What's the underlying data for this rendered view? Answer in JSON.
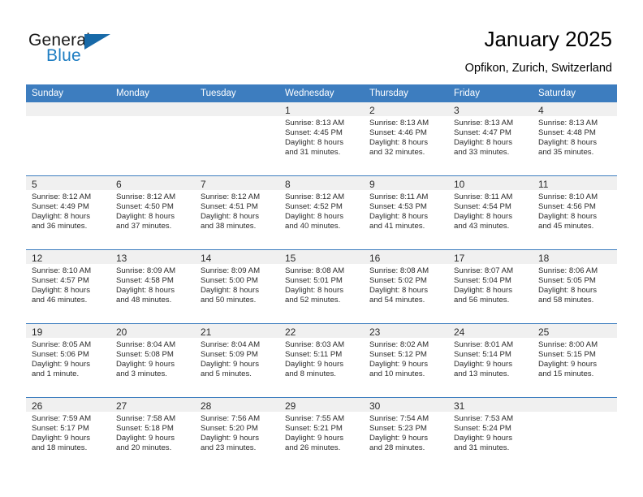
{
  "brand": {
    "name_part1": "General",
    "name_part2": "Blue",
    "triangle_color": "#1769a8",
    "blue_color": "#1f7ec2"
  },
  "header": {
    "title": "January 2025",
    "location": "Opfikon, Zurich, Switzerland",
    "header_bg": "#3d7dbf",
    "header_text_color": "#ffffff"
  },
  "weekday_headers": [
    "Sunday",
    "Monday",
    "Tuesday",
    "Wednesday",
    "Thursday",
    "Friday",
    "Saturday"
  ],
  "weeks": [
    [
      {
        "day": "",
        "lines": []
      },
      {
        "day": "",
        "lines": []
      },
      {
        "day": "",
        "lines": []
      },
      {
        "day": "1",
        "lines": [
          "Sunrise: 8:13 AM",
          "Sunset: 4:45 PM",
          "Daylight: 8 hours",
          "and 31 minutes."
        ]
      },
      {
        "day": "2",
        "lines": [
          "Sunrise: 8:13 AM",
          "Sunset: 4:46 PM",
          "Daylight: 8 hours",
          "and 32 minutes."
        ]
      },
      {
        "day": "3",
        "lines": [
          "Sunrise: 8:13 AM",
          "Sunset: 4:47 PM",
          "Daylight: 8 hours",
          "and 33 minutes."
        ]
      },
      {
        "day": "4",
        "lines": [
          "Sunrise: 8:13 AM",
          "Sunset: 4:48 PM",
          "Daylight: 8 hours",
          "and 35 minutes."
        ]
      }
    ],
    [
      {
        "day": "5",
        "lines": [
          "Sunrise: 8:12 AM",
          "Sunset: 4:49 PM",
          "Daylight: 8 hours",
          "and 36 minutes."
        ]
      },
      {
        "day": "6",
        "lines": [
          "Sunrise: 8:12 AM",
          "Sunset: 4:50 PM",
          "Daylight: 8 hours",
          "and 37 minutes."
        ]
      },
      {
        "day": "7",
        "lines": [
          "Sunrise: 8:12 AM",
          "Sunset: 4:51 PM",
          "Daylight: 8 hours",
          "and 38 minutes."
        ]
      },
      {
        "day": "8",
        "lines": [
          "Sunrise: 8:12 AM",
          "Sunset: 4:52 PM",
          "Daylight: 8 hours",
          "and 40 minutes."
        ]
      },
      {
        "day": "9",
        "lines": [
          "Sunrise: 8:11 AM",
          "Sunset: 4:53 PM",
          "Daylight: 8 hours",
          "and 41 minutes."
        ]
      },
      {
        "day": "10",
        "lines": [
          "Sunrise: 8:11 AM",
          "Sunset: 4:54 PM",
          "Daylight: 8 hours",
          "and 43 minutes."
        ]
      },
      {
        "day": "11",
        "lines": [
          "Sunrise: 8:10 AM",
          "Sunset: 4:56 PM",
          "Daylight: 8 hours",
          "and 45 minutes."
        ]
      }
    ],
    [
      {
        "day": "12",
        "lines": [
          "Sunrise: 8:10 AM",
          "Sunset: 4:57 PM",
          "Daylight: 8 hours",
          "and 46 minutes."
        ]
      },
      {
        "day": "13",
        "lines": [
          "Sunrise: 8:09 AM",
          "Sunset: 4:58 PM",
          "Daylight: 8 hours",
          "and 48 minutes."
        ]
      },
      {
        "day": "14",
        "lines": [
          "Sunrise: 8:09 AM",
          "Sunset: 5:00 PM",
          "Daylight: 8 hours",
          "and 50 minutes."
        ]
      },
      {
        "day": "15",
        "lines": [
          "Sunrise: 8:08 AM",
          "Sunset: 5:01 PM",
          "Daylight: 8 hours",
          "and 52 minutes."
        ]
      },
      {
        "day": "16",
        "lines": [
          "Sunrise: 8:08 AM",
          "Sunset: 5:02 PM",
          "Daylight: 8 hours",
          "and 54 minutes."
        ]
      },
      {
        "day": "17",
        "lines": [
          "Sunrise: 8:07 AM",
          "Sunset: 5:04 PM",
          "Daylight: 8 hours",
          "and 56 minutes."
        ]
      },
      {
        "day": "18",
        "lines": [
          "Sunrise: 8:06 AM",
          "Sunset: 5:05 PM",
          "Daylight: 8 hours",
          "and 58 minutes."
        ]
      }
    ],
    [
      {
        "day": "19",
        "lines": [
          "Sunrise: 8:05 AM",
          "Sunset: 5:06 PM",
          "Daylight: 9 hours",
          "and 1 minute."
        ]
      },
      {
        "day": "20",
        "lines": [
          "Sunrise: 8:04 AM",
          "Sunset: 5:08 PM",
          "Daylight: 9 hours",
          "and 3 minutes."
        ]
      },
      {
        "day": "21",
        "lines": [
          "Sunrise: 8:04 AM",
          "Sunset: 5:09 PM",
          "Daylight: 9 hours",
          "and 5 minutes."
        ]
      },
      {
        "day": "22",
        "lines": [
          "Sunrise: 8:03 AM",
          "Sunset: 5:11 PM",
          "Daylight: 9 hours",
          "and 8 minutes."
        ]
      },
      {
        "day": "23",
        "lines": [
          "Sunrise: 8:02 AM",
          "Sunset: 5:12 PM",
          "Daylight: 9 hours",
          "and 10 minutes."
        ]
      },
      {
        "day": "24",
        "lines": [
          "Sunrise: 8:01 AM",
          "Sunset: 5:14 PM",
          "Daylight: 9 hours",
          "and 13 minutes."
        ]
      },
      {
        "day": "25",
        "lines": [
          "Sunrise: 8:00 AM",
          "Sunset: 5:15 PM",
          "Daylight: 9 hours",
          "and 15 minutes."
        ]
      }
    ],
    [
      {
        "day": "26",
        "lines": [
          "Sunrise: 7:59 AM",
          "Sunset: 5:17 PM",
          "Daylight: 9 hours",
          "and 18 minutes."
        ]
      },
      {
        "day": "27",
        "lines": [
          "Sunrise: 7:58 AM",
          "Sunset: 5:18 PM",
          "Daylight: 9 hours",
          "and 20 minutes."
        ]
      },
      {
        "day": "28",
        "lines": [
          "Sunrise: 7:56 AM",
          "Sunset: 5:20 PM",
          "Daylight: 9 hours",
          "and 23 minutes."
        ]
      },
      {
        "day": "29",
        "lines": [
          "Sunrise: 7:55 AM",
          "Sunset: 5:21 PM",
          "Daylight: 9 hours",
          "and 26 minutes."
        ]
      },
      {
        "day": "30",
        "lines": [
          "Sunrise: 7:54 AM",
          "Sunset: 5:23 PM",
          "Daylight: 9 hours",
          "and 28 minutes."
        ]
      },
      {
        "day": "31",
        "lines": [
          "Sunrise: 7:53 AM",
          "Sunset: 5:24 PM",
          "Daylight: 9 hours",
          "and 31 minutes."
        ]
      },
      {
        "day": "",
        "lines": []
      }
    ]
  ]
}
